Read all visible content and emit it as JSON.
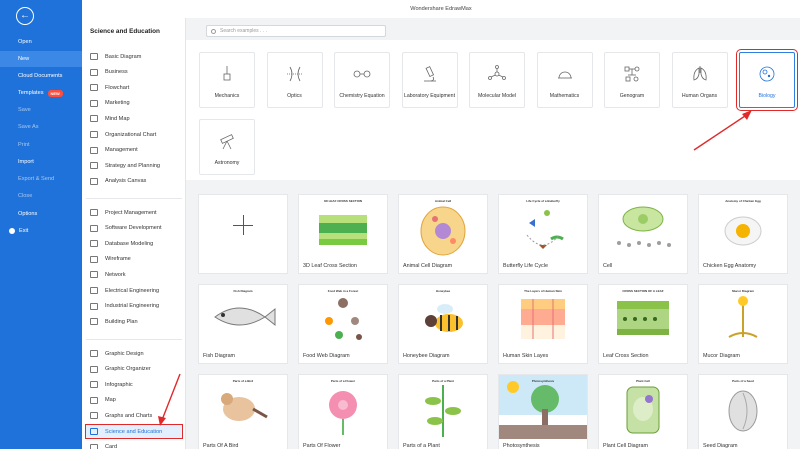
{
  "window": {
    "title": "Wondershare EdrawMax"
  },
  "nav": {
    "items": [
      {
        "label": "Open",
        "dim": false
      },
      {
        "label": "New",
        "dim": false,
        "active": true
      },
      {
        "label": "Cloud Documents",
        "dim": false
      },
      {
        "label": "Templates",
        "dim": false,
        "badge": "NEW"
      },
      {
        "label": "Save",
        "dim": true
      },
      {
        "label": "Save As",
        "dim": true
      },
      {
        "label": "Print",
        "dim": true
      },
      {
        "label": "Import",
        "dim": false
      },
      {
        "label": "Export & Send",
        "dim": true
      },
      {
        "label": "Close",
        "dim": true
      },
      {
        "label": "Options",
        "dim": false
      },
      {
        "label": "Exit",
        "dim": false
      }
    ]
  },
  "sidebar": {
    "title": "Science and Education",
    "groups": [
      [
        "Basic Diagram",
        "Business",
        "Flowchart",
        "Marketing",
        "Mind Map",
        "Organizational Chart",
        "Management",
        "Strategy and Planning",
        "Analysis Canvas"
      ],
      [
        "Project Management",
        "Software Development",
        "Database Modeling",
        "Wireframe",
        "Network",
        "Electrical Engineering",
        "Industrial Engineering",
        "Building Plan"
      ],
      [
        "Graphic Design",
        "Graphic Organizer",
        "Infographic",
        "Map",
        "Graphs and Charts",
        "Science and Education",
        "Card"
      ]
    ],
    "selected": "Science and Education"
  },
  "search": {
    "placeholder": "Search examples . . ."
  },
  "examples": [
    {
      "label": "Mechanics",
      "icon": "mechanics-icon"
    },
    {
      "label": "Optics",
      "icon": "optics-icon"
    },
    {
      "label": "Chemistry Equation",
      "icon": "chemistry-icon"
    },
    {
      "label": "Laboratory Equipment",
      "icon": "microscope-icon"
    },
    {
      "label": "Molecular Model",
      "icon": "molecule-icon"
    },
    {
      "label": "Mathematics",
      "icon": "mathematics-icon"
    },
    {
      "label": "Genogram",
      "icon": "genogram-icon"
    },
    {
      "label": "Human Organs",
      "icon": "lungs-icon"
    },
    {
      "label": "Biology",
      "icon": "biology-icon",
      "active": true
    },
    {
      "label": "Astronomy",
      "icon": "telescope-icon"
    }
  ],
  "templates": [
    {
      "label": "",
      "blank": true
    },
    {
      "label": "3D Leaf Cross Section",
      "thumb_title": "3D LEAF CROSS SECTION"
    },
    {
      "label": "Animal Cell Diagram",
      "thumb_title": "Animal Cell"
    },
    {
      "label": "Butterfly Life Cycle",
      "thumb_title": "Life Cycle of a Butterfly"
    },
    {
      "label": "Cell",
      "thumb_title": ""
    },
    {
      "label": "Chicken Egg Anatomy",
      "thumb_title": "Anatomy of Chicken Egg"
    },
    {
      "label": "Fish Diagram",
      "thumb_title": "Fish Diagram"
    },
    {
      "label": "Food Web Diagram",
      "thumb_title": "Food Web in a Forest"
    },
    {
      "label": "Honeybee Diagram",
      "thumb_title": "Honeybee"
    },
    {
      "label": "Human Skin Layes",
      "thumb_title": "The Layers of Human Skin"
    },
    {
      "label": "Leaf Cross Section",
      "thumb_title": "CROSS SECTION OF A LEAF"
    },
    {
      "label": "Mucor Diagram",
      "thumb_title": "Mucor Diagram"
    },
    {
      "label": "Parts Of A Bird",
      "thumb_title": "Parts of a Bird"
    },
    {
      "label": "Parts Of Flower",
      "thumb_title": "Parts of a Flower"
    },
    {
      "label": "Parts of a Plant",
      "thumb_title": "Parts of a Plant"
    },
    {
      "label": "Photosynthesis",
      "thumb_title": "Photosynthesis"
    },
    {
      "label": "Plant Cell Diagram",
      "thumb_title": "Plant Cell"
    },
    {
      "label": "Seed Diagram",
      "thumb_title": "Parts of a Seed"
    }
  ],
  "colors": {
    "nav_bg": "#1f72d9",
    "accent": "#2f7fe0",
    "highlight": "#e02a2a",
    "badge": "#ff4d3d"
  }
}
